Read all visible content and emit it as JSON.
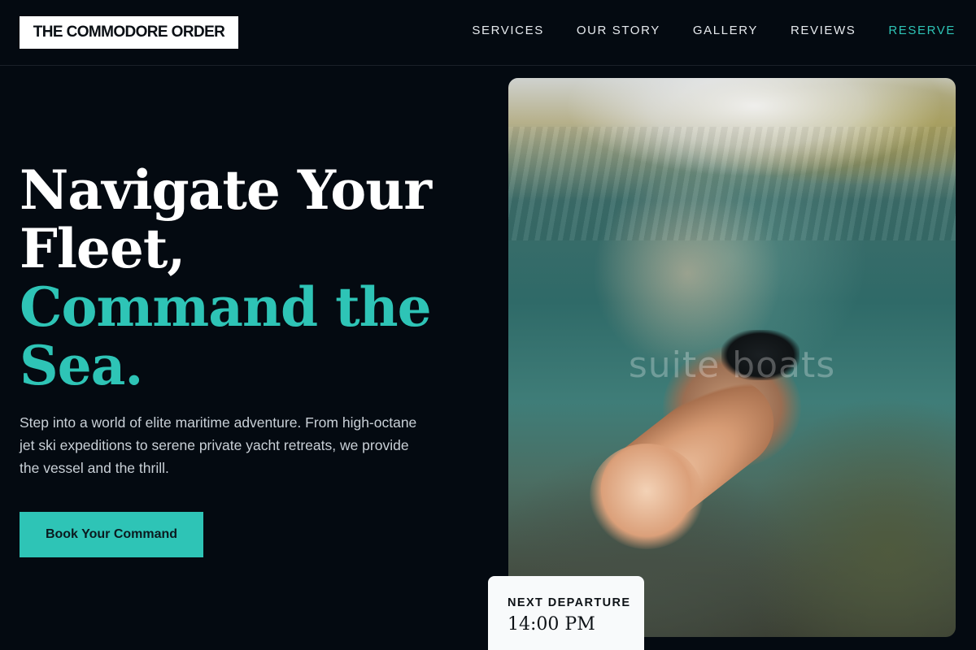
{
  "brand": {
    "name": "THE COMMODORE ORDER"
  },
  "nav": {
    "items": [
      {
        "label": "SERVICES"
      },
      {
        "label": "OUR STORY"
      },
      {
        "label": "GALLERY"
      },
      {
        "label": "REVIEWS"
      },
      {
        "label": "RESERVE"
      }
    ]
  },
  "hero": {
    "headline_line1": "Navigate Your",
    "headline_line2": "Fleet,",
    "headline_line3": "Command the",
    "headline_line4": "Sea.",
    "subtext": "Step into a world of elite maritime adventure. From high-octane jet ski expeditions to serene private yacht retreats, we provide the vessel and the thrill.",
    "cta_label": "Book Your Command",
    "image_watermark": "suite boats"
  },
  "departure": {
    "label": "NEXT DEPARTURE",
    "time": "14:00 PM"
  },
  "colors": {
    "background": "#040a11",
    "accent": "#2ec4b6",
    "text": "#ffffff"
  }
}
